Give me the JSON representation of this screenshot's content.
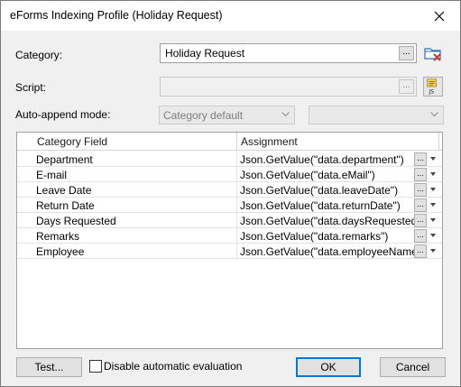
{
  "window": {
    "title": "eForms Indexing Profile (Holiday Request)"
  },
  "category": {
    "label": "Category:",
    "value": "Holiday Request",
    "browse": "..."
  },
  "script": {
    "label": "Script:",
    "value": "",
    "browse": "...",
    "icon_text": "JS"
  },
  "auto_append": {
    "label": "Auto-append mode:",
    "selected": "Category default",
    "second_selected": ""
  },
  "grid": {
    "headers": {
      "field": "Category Field",
      "assignment": "Assignment"
    },
    "rows": [
      {
        "field": "Department",
        "assignment": "Json.GetValue(\"data.department\")"
      },
      {
        "field": "E-mail",
        "assignment": "Json.GetValue(\"data.eMail\")"
      },
      {
        "field": "Leave Date",
        "assignment": "Json.GetValue(\"data.leaveDate\")"
      },
      {
        "field": "Return Date",
        "assignment": "Json.GetValue(\"data.returnDate\")"
      },
      {
        "field": "Days Requested",
        "assignment": "Json.GetValue(\"data.daysRequested\")"
      },
      {
        "field": "Remarks",
        "assignment": "Json.GetValue(\"data.remarks\")"
      },
      {
        "field": "Employee",
        "assignment": "Json.GetValue(\"data.employeeName\")"
      }
    ],
    "row_button": "..."
  },
  "footer": {
    "test_label": "Test...",
    "disable_eval_label": "Disable automatic evaluation",
    "disable_eval_checked": false,
    "ok_label": "OK",
    "cancel_label": "Cancel"
  },
  "icons": {
    "close": "close-icon",
    "category_remove": "folder-remove-icon",
    "script_edit": "script-edit-icon",
    "dropdown": "chevron-down-icon"
  },
  "colors": {
    "accent": "#0078d7",
    "remove": "#d0342c",
    "folder": "#2f6fb5"
  }
}
